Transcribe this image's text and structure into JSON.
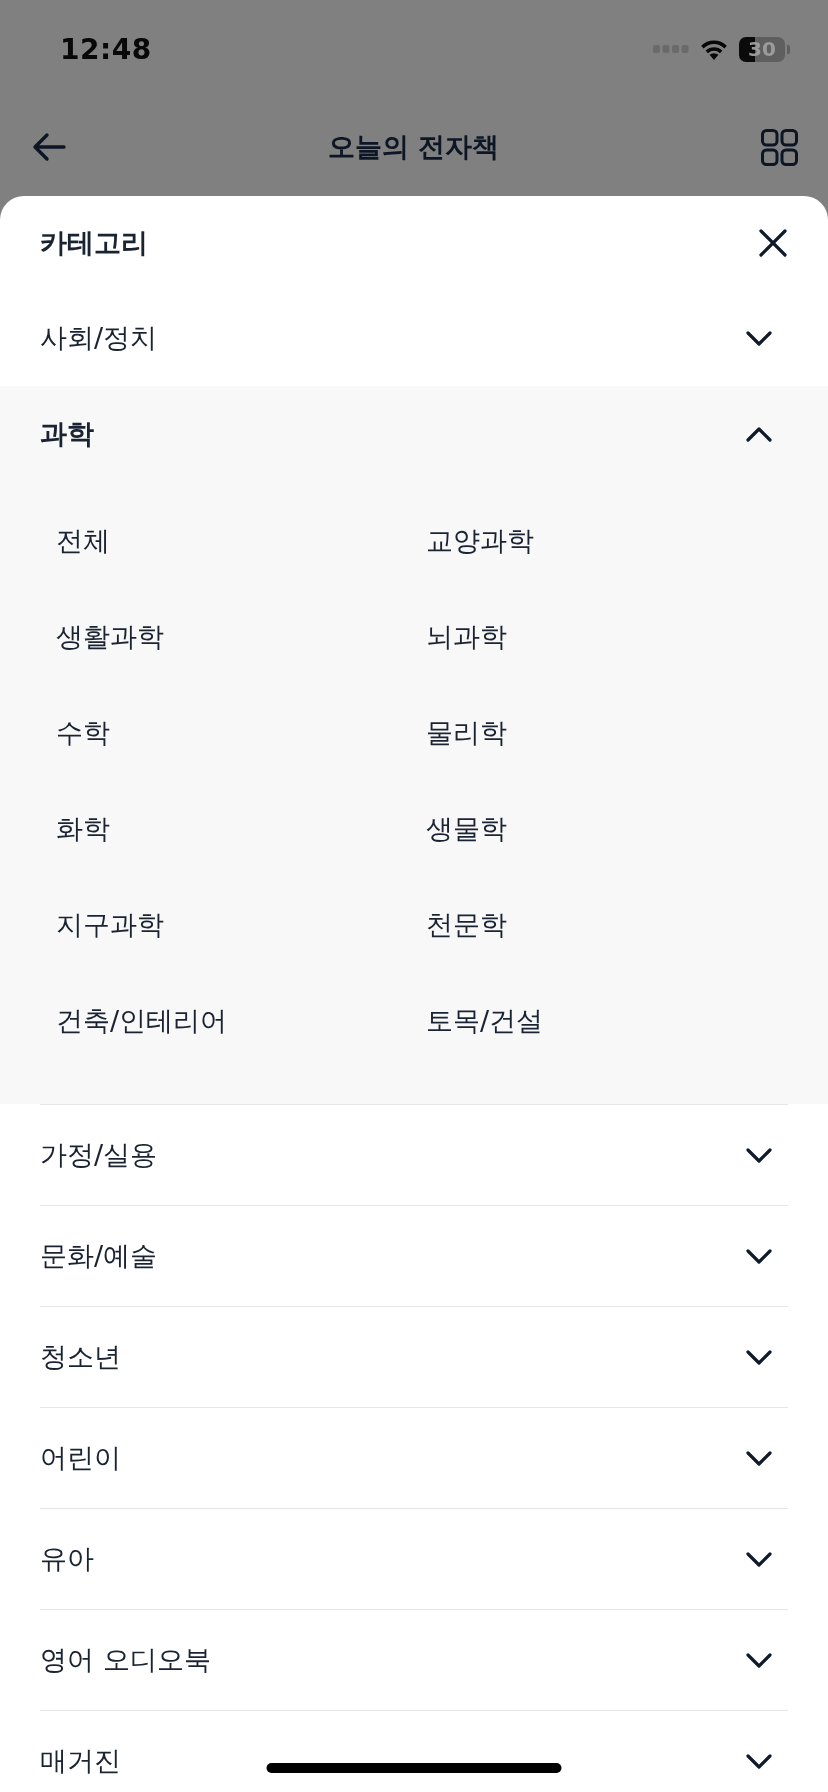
{
  "status_bar": {
    "time": "12:48",
    "battery": "30"
  },
  "nav_bar": {
    "title": "오늘의 전자책"
  },
  "sheet": {
    "title": "카테고리",
    "categories": [
      {
        "label": "사회/정치",
        "expanded": false
      },
      {
        "label": "과학",
        "expanded": true,
        "children": [
          {
            "label": "전체"
          },
          {
            "label": "교양과학"
          },
          {
            "label": "생활과학"
          },
          {
            "label": "뇌과학"
          },
          {
            "label": "수학"
          },
          {
            "label": "물리학"
          },
          {
            "label": "화학"
          },
          {
            "label": "생물학"
          },
          {
            "label": "지구과학"
          },
          {
            "label": "천문학"
          },
          {
            "label": "건축/인테리어"
          },
          {
            "label": "토목/건설"
          }
        ]
      },
      {
        "label": "가정/실용",
        "expanded": false
      },
      {
        "label": "문화/예술",
        "expanded": false
      },
      {
        "label": "청소년",
        "expanded": false
      },
      {
        "label": "어린이",
        "expanded": false
      },
      {
        "label": "유아",
        "expanded": false
      },
      {
        "label": "영어 오디오북",
        "expanded": false
      },
      {
        "label": "매거진",
        "expanded": false
      }
    ]
  }
}
